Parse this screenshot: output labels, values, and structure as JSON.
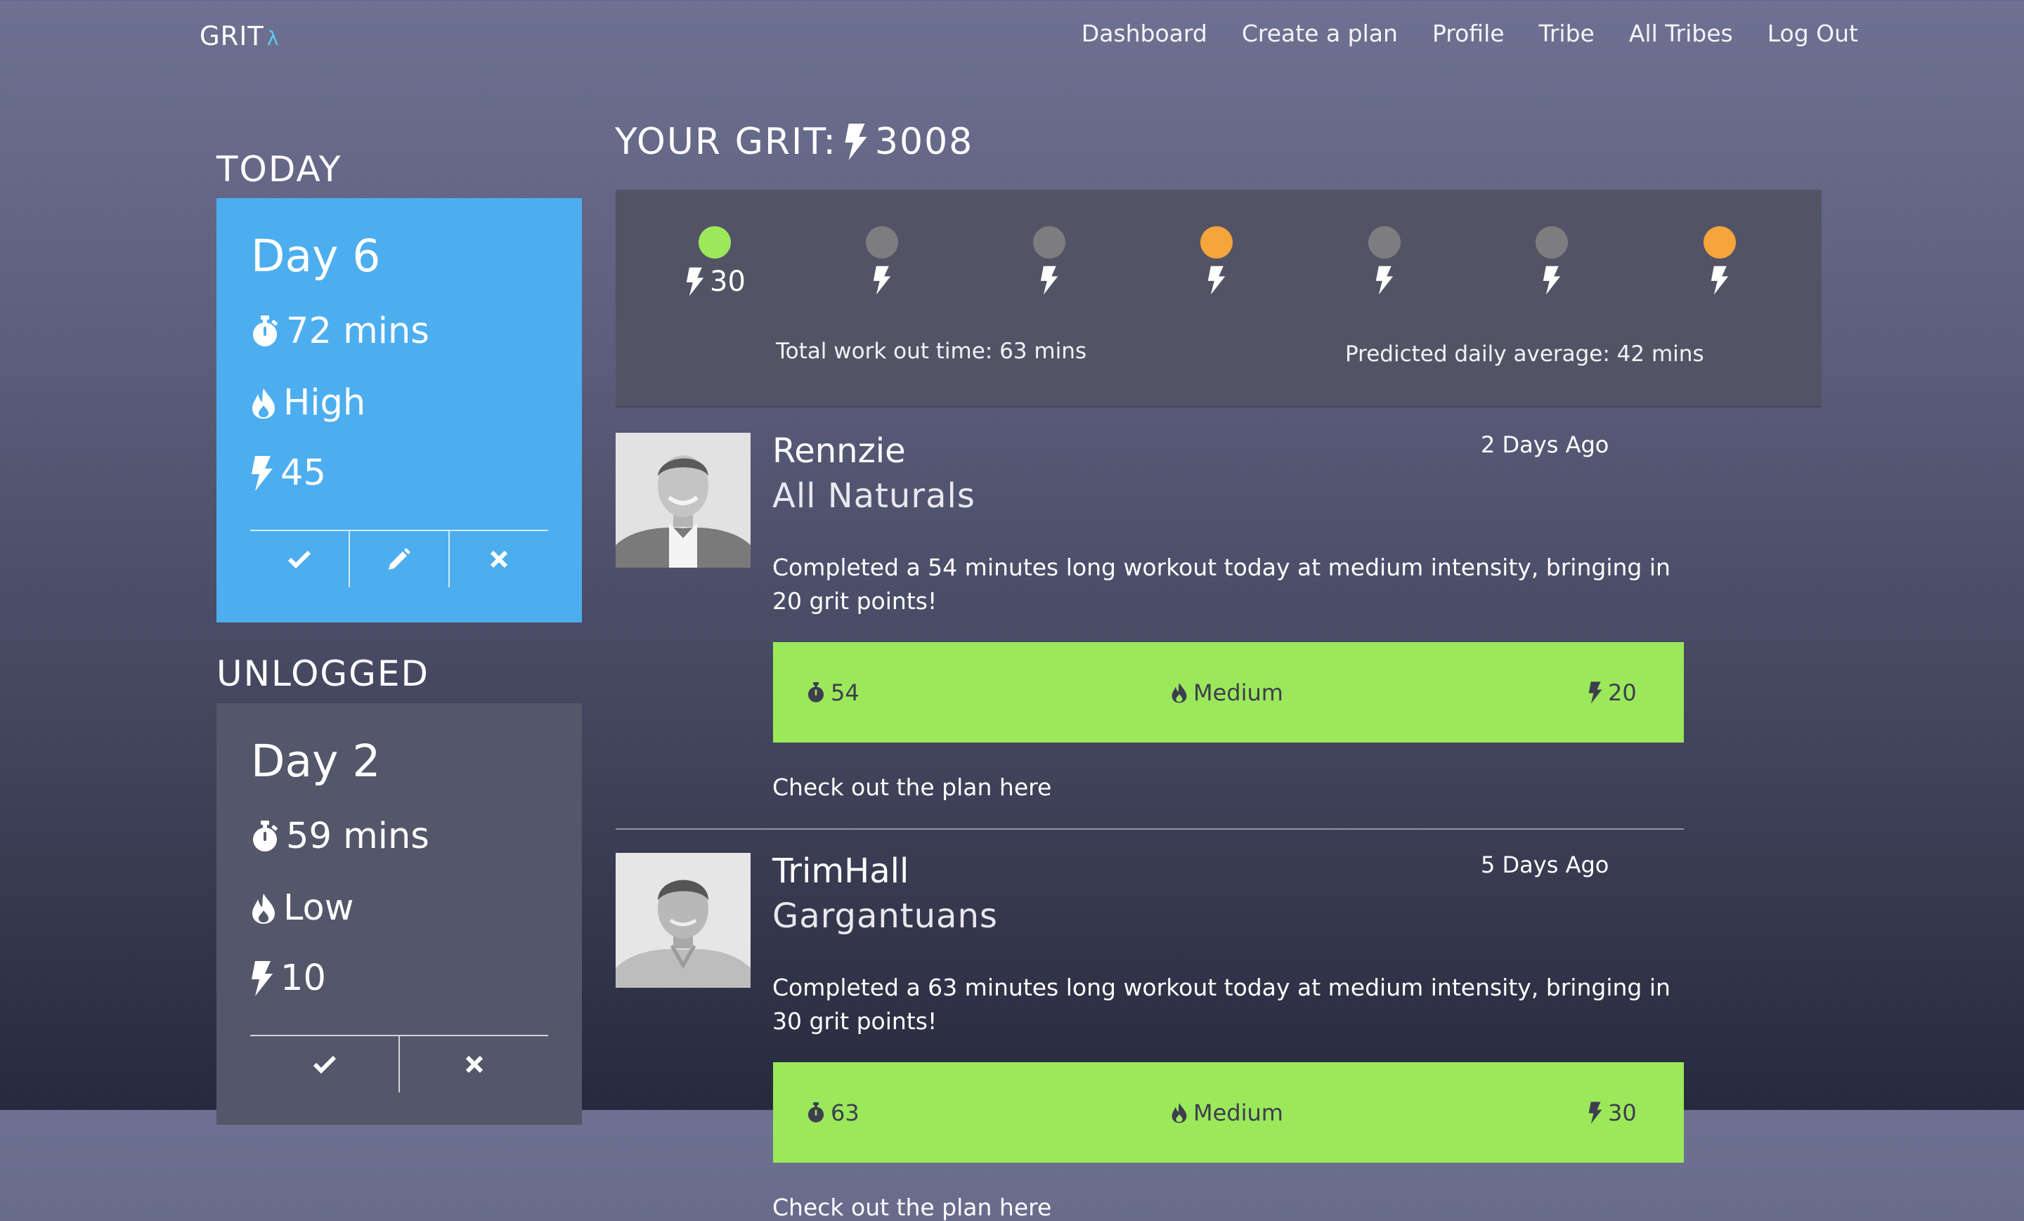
{
  "nav": {
    "brand": "GRIT",
    "brand_mark": "λ",
    "links": [
      "Dashboard",
      "Create a plan",
      "Profile",
      "Tribe",
      "All Tribes",
      "Log Out"
    ]
  },
  "today": {
    "heading": "TODAY",
    "day": "Day 6",
    "duration": "72 mins",
    "intensity": "High",
    "points": "45",
    "color": "#4daeef"
  },
  "unlogged": {
    "heading": "UNLOGGED",
    "day": "Day 2",
    "duration": "59 mins",
    "intensity": "Low",
    "points": "10",
    "color": "#545669"
  },
  "grit": {
    "label": "YOUR GRIT:",
    "score": "3008"
  },
  "week": {
    "days": [
      {
        "status": "done",
        "color": "#9ce85b",
        "points": "30"
      },
      {
        "status": "none",
        "color": "#7d7d7f",
        "points": ""
      },
      {
        "status": "none",
        "color": "#7d7d7f",
        "points": ""
      },
      {
        "status": "rest",
        "color": "#f5a53c",
        "points": ""
      },
      {
        "status": "none",
        "color": "#7d7d7f",
        "points": ""
      },
      {
        "status": "none",
        "color": "#7d7d7f",
        "points": ""
      },
      {
        "status": "rest",
        "color": "#f5a53c",
        "points": ""
      }
    ],
    "total_text": "Total work out time: 63 mins",
    "predicted_text": "Predicted daily average: 42 mins"
  },
  "feed": [
    {
      "name": "Rennzie",
      "tribe": "All Naturals",
      "time": "2 Days Ago",
      "text": "Completed a 54 minutes long workout today at medium intensity, bringing in 20 grit points!",
      "duration": "54",
      "intensity": "Medium",
      "points": "20",
      "link": "Check out the plan here"
    },
    {
      "name": "TrimHall",
      "tribe": "Gargantuans",
      "time": "5 Days Ago",
      "text": "Completed a 63 minutes long workout today at medium intensity, bringing in 30 grit points!",
      "duration": "63",
      "intensity": "Medium",
      "points": "30",
      "link": "Check out the plan here"
    }
  ],
  "icons": {
    "timer": "stopwatch-icon",
    "intensity": "flame-icon",
    "points": "lightning-icon",
    "confirm": "check-icon",
    "edit": "pencil-icon",
    "delete": "close-icon"
  }
}
